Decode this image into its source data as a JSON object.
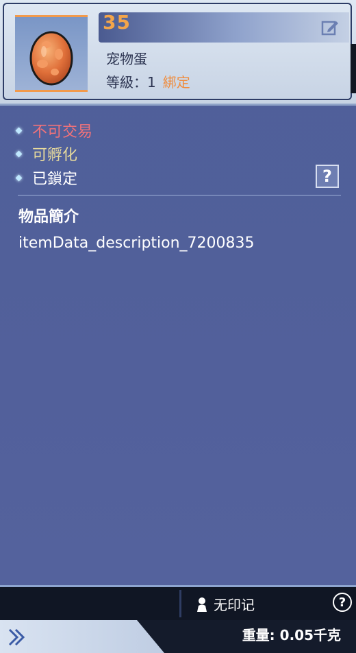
{
  "item": {
    "number": "35",
    "name": "宠物蛋",
    "level_label": "等級：",
    "level_value": "1",
    "bound_label": "綁定",
    "icon": "pet-egg-icon"
  },
  "properties": [
    {
      "label": "不可交易",
      "color": "#f0727a"
    },
    {
      "label": "可孵化",
      "color": "#e7da9c"
    },
    {
      "label": "已鎖定",
      "color": "#ffffff"
    }
  ],
  "help_button_label": "?",
  "description": {
    "title": "物品簡介",
    "text": "itemData_description_7200835"
  },
  "footer": {
    "imprint_label": "无印记",
    "help_label": "?",
    "weight_label": "重量: 0.05千克"
  },
  "colors": {
    "accent_orange": "#f3a54a",
    "panel_blue": "#52609b",
    "header_light": "#dfe8f3"
  }
}
